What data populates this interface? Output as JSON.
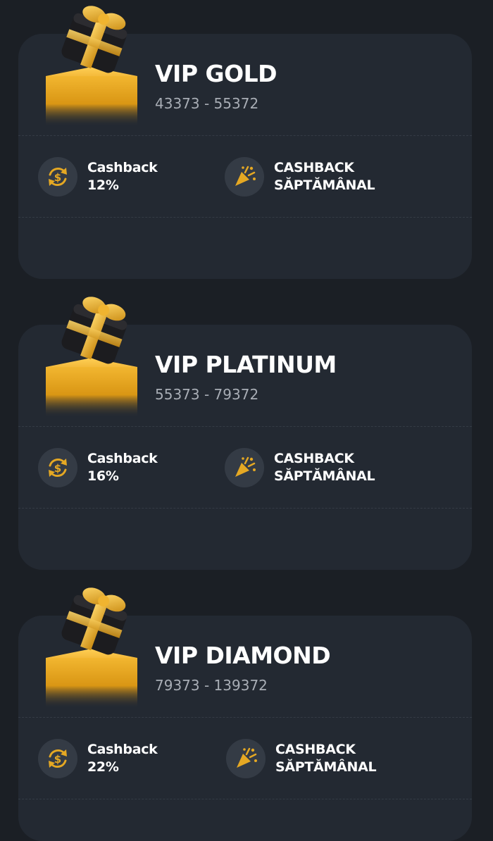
{
  "colors": {
    "background": "#1b1f25",
    "card": "#232932",
    "accent_gold": "#e5a823",
    "icon_bg": "#343b45",
    "muted_text": "#a8adb5"
  },
  "tiers": [
    {
      "title": "VIP GOLD",
      "range": "43373 - 55372",
      "cashback_label": "Cashback",
      "cashback_value": "12%",
      "weekly_line1": "CASHBACK",
      "weekly_line2": "SĂPTĂMÂNAL"
    },
    {
      "title": "VIP PLATINUM",
      "range": "55373 - 79372",
      "cashback_label": "Cashback",
      "cashback_value": "16%",
      "weekly_line1": "CASHBACK",
      "weekly_line2": "SĂPTĂMÂNAL"
    },
    {
      "title": "VIP DIAMOND",
      "range": "79373 - 139372",
      "cashback_label": "Cashback",
      "cashback_value": "22%",
      "weekly_line1": "CASHBACK",
      "weekly_line2": "SĂPTĂMÂNAL"
    }
  ],
  "icons": {
    "cashback": "cashback-cycle-icon",
    "weekly": "party-popper-icon",
    "gift": "gift-box-icon"
  }
}
